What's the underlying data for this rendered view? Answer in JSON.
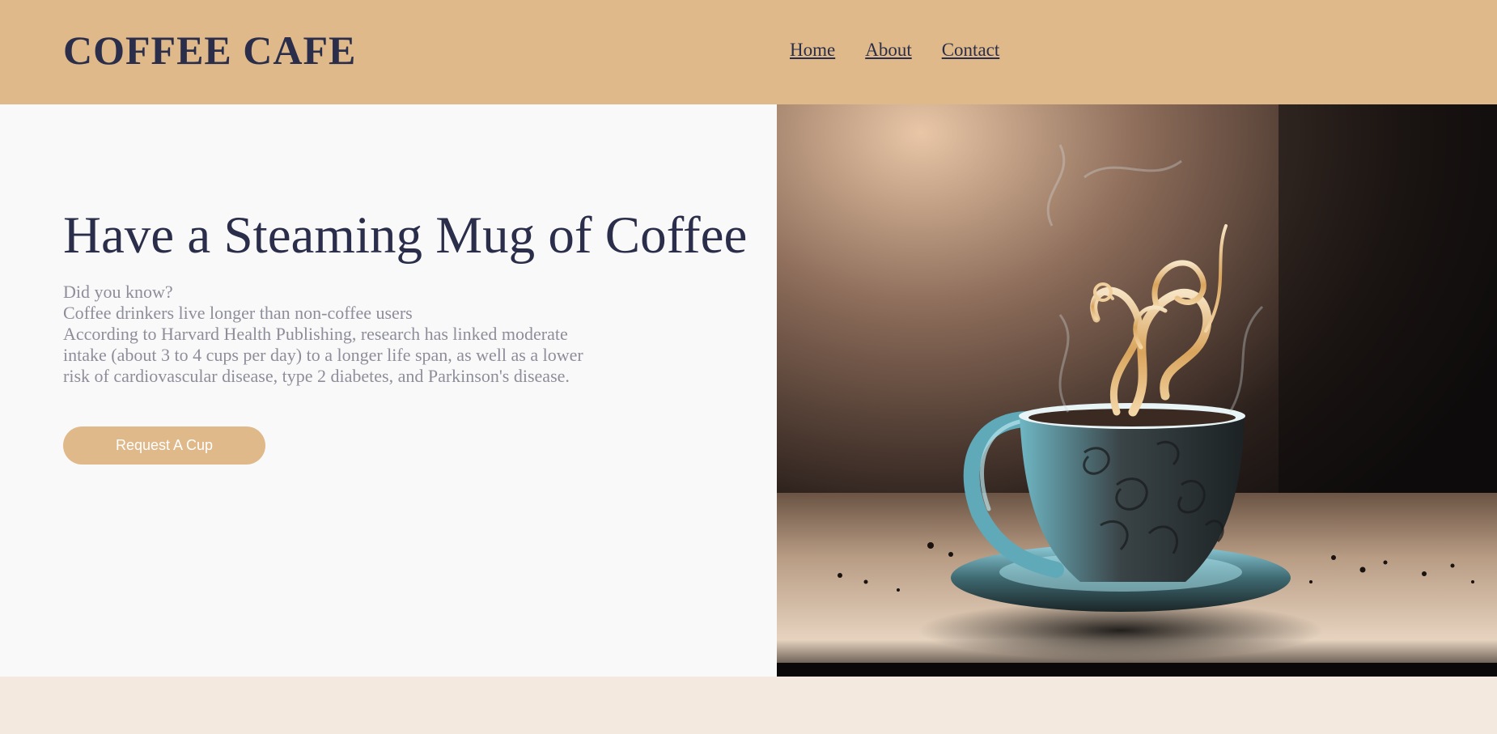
{
  "header": {
    "logo": "COFFEE CAFE",
    "nav": [
      {
        "label": "Home"
      },
      {
        "label": "About"
      },
      {
        "label": "Contact"
      }
    ]
  },
  "hero": {
    "title": "Have a Steaming Mug of Coffee",
    "lines": [
      "Did you know?",
      "Coffee drinkers live longer than non-coffee users",
      "According to Harvard Health Publishing, research has linked moderate intake (about 3 to 4 cups per day) to a longer life span, as well as a lower risk of cardiovascular disease, type 2 diabetes, and Parkinson's disease."
    ],
    "cta_label": "Request A Cup",
    "image_subject": "steaming coffee cup on saucer"
  },
  "colors": {
    "header_bg": "#dfb989",
    "accent": "#dfb989",
    "heading_text": "#2b2e4a",
    "body_text": "#8e8e9a",
    "hero_bg": "#f9f9fa",
    "page_bg": "#f3e9df"
  }
}
